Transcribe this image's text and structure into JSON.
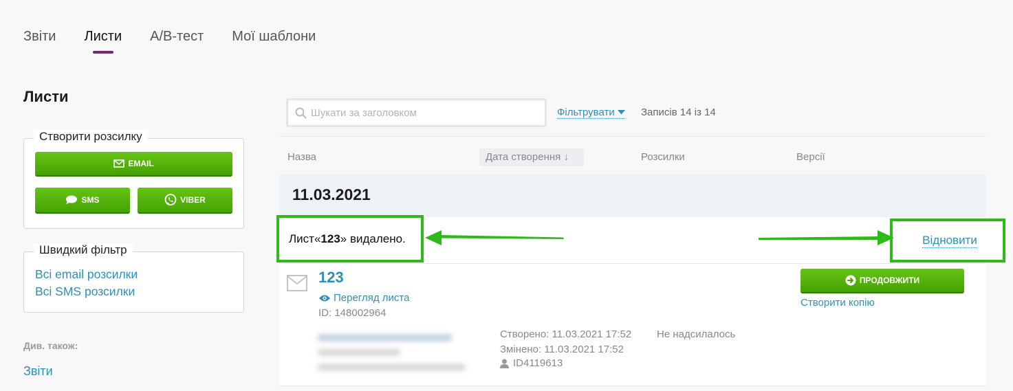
{
  "tabs": [
    {
      "label": "Звіти",
      "active": false
    },
    {
      "label": "Листи",
      "active": true
    },
    {
      "label": "A/B-тест",
      "active": false
    },
    {
      "label": "Мої шаблони",
      "active": false
    }
  ],
  "page_title": "Листи",
  "create": {
    "legend": "Створити розсилку",
    "email_label": "EMAIL",
    "sms_label": "SMS",
    "viber_label": "VIBER"
  },
  "quick_filter": {
    "legend": "Швидкий фільтр",
    "links": [
      "Всі email розсилки",
      "Всі SMS розсилки"
    ]
  },
  "see_also": {
    "label": "Див. також:",
    "link": "Звіти"
  },
  "search": {
    "placeholder": "Шукати за заголовком",
    "value": ""
  },
  "filter_label": "Фільтрувати",
  "records_text": "Записів 14 із 14",
  "columns": {
    "name": "Назва",
    "date": "Дата створення ↓",
    "mailings": "Розсилки",
    "versions": "Версії"
  },
  "group_date": "11.03.2021",
  "deleted_notice": {
    "prefix": "Лист«",
    "name": "123",
    "suffix": "» видалено.",
    "restore": "Відновити"
  },
  "item": {
    "name": "123",
    "preview": "Перегляд листа",
    "id": "ID: 148002964",
    "created": "Створено: 11.03.2021 17:52",
    "modified": "Змінено: 11.03.2021 17:52",
    "author_id": "ID4119613",
    "status": "Не надсилалось",
    "continue_label": "ПРОДОВЖИТИ",
    "copy_label": "Створити копію"
  },
  "colors": {
    "accent": "#7a2570",
    "green": "#4aaa05",
    "link": "#2f8fb5",
    "highlight": "#2eba19"
  }
}
